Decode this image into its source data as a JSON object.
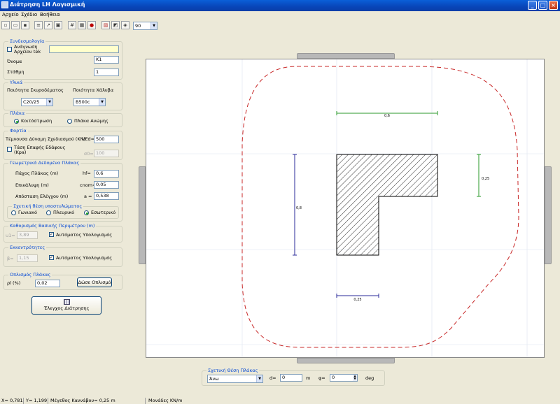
{
  "window": {
    "title": "Διάτρηση LH Λογισμική"
  },
  "menu": [
    "Αρχείο",
    "Σχέδιο",
    "Βοήθεια"
  ],
  "toolbar": {
    "zoom_value": "90"
  },
  "link": {
    "title": "Συνδεσμολογία",
    "read_label": "Ανάγνωση Αρχείου tek",
    "name_label": "Όνομα",
    "name_value": "K1",
    "level_label": "Στάθμη",
    "level_value": "1"
  },
  "materials": {
    "title": "Υλικά",
    "concrete_label": "Ποιότητα Σκυροδέματος",
    "concrete_value": "C20/25",
    "steel_label": "Ποιότητα Χάλυβα",
    "steel_value": "B500c"
  },
  "slab": {
    "title": "Πλάκα",
    "option1": "Κοιτόστρωση",
    "option2": "Πλάκα Ανώμης"
  },
  "loads": {
    "title": "Φορτία",
    "ved_label": "Τέμνουσα Δύναμη Σχεδιασμού (KN)",
    "ved_sym": "VEd=",
    "ved_value": "500",
    "soil_label": "Τάση Επαφής Εδάφους (Kpa)",
    "soil_sym": "σ0=",
    "soil_value": "100"
  },
  "geometry": {
    "title": "Γεωμετρικά Δεδομένα Πλάκας",
    "thickness_label": "Πάχος Πλάκας (m)",
    "thickness_sym": "hf=",
    "thickness_value": "0,6",
    "cover_label": "Επικάλυψη (m)",
    "cover_sym": "cnom=",
    "cover_value": "0,05",
    "dist_label": "Απόσταση Ελέγχου (m)",
    "dist_sym": "a =",
    "dist_value": "0,538",
    "position_title": "Σχετική θέση υποστυλώματος",
    "pos1": "Γωνιακό",
    "pos2": "Πλευρικό",
    "pos3": "Εσωτερικό"
  },
  "perimeter": {
    "title": "Καθορισμός Βασικής Περιμέτρου (m)",
    "sym": "u1=",
    "value": "3,89",
    "auto_label": "Αυτόματος Υπολογισμός"
  },
  "eccentricity": {
    "title": "Εκκεντρότητες",
    "sym": "β=",
    "value": "1,15",
    "auto_label": "Αυτόματος Υπολογισμός"
  },
  "reinforcement": {
    "title": "Οπλισμός Πλάκας",
    "label": "ρl (%)",
    "value": "0,02",
    "button": "Δώσε Οπλισμό"
  },
  "check_button": "Έλεγχος Διάτρησης",
  "drawing": {
    "dim_top": "0,6",
    "dim_left": "0,8",
    "dim_right": "0,25",
    "dim_bottom": "0,25"
  },
  "position_panel": {
    "title": "Σχετική Θέση Πλάκας",
    "select_value": "Άνω",
    "d_label": "d=",
    "d_value": "0",
    "d_unit": "m",
    "phi_label": "φ=",
    "phi_value": "0",
    "phi_unit": "deg"
  },
  "status": {
    "x": "X= 0,781",
    "y": "Y= 1,199",
    "canvas": "Μέγεθος Καννάβου= 0,25 m",
    "units": "Μονάδες KN/m"
  }
}
